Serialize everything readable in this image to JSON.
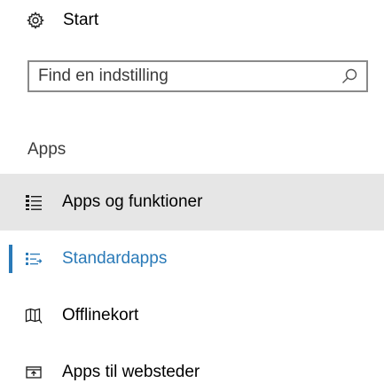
{
  "home": {
    "label": "Start",
    "icon": "gear-icon"
  },
  "search": {
    "placeholder": "Find en indstilling",
    "value": "",
    "icon": "search-icon"
  },
  "section": {
    "title": "Apps"
  },
  "nav": {
    "items": [
      {
        "label": "Apps og funktioner",
        "icon": "apps-list-icon",
        "state": "hover"
      },
      {
        "label": "Standardapps",
        "icon": "default-apps-icon",
        "state": "selected"
      },
      {
        "label": "Offlinekort",
        "icon": "map-icon",
        "state": "normal"
      },
      {
        "label": "Apps til websteder",
        "icon": "open-website-icon",
        "state": "normal"
      }
    ]
  },
  "colors": {
    "accent": "#2a7ab8",
    "hover_bg": "#e6e6e6",
    "search_border": "#8a8a8a",
    "text": "#000000",
    "section_text": "#3c3c3c"
  }
}
